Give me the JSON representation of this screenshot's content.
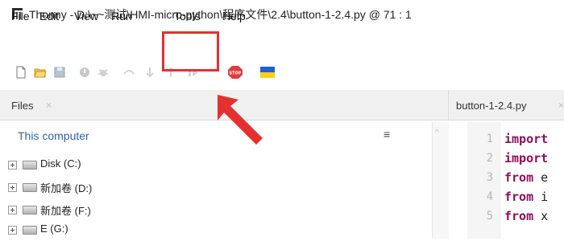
{
  "window": {
    "title": "Thonny  -  D:\\~~测试\\HMI-micro-python\\程序文件\\2.4\\button-1-2.4.py  @  71 : 1"
  },
  "menu": {
    "items": [
      "File",
      "Edit",
      "View",
      "Run",
      "Tools",
      "Help"
    ],
    "highlighted": "Tools"
  },
  "toolbar": {
    "icons": [
      "new-file-icon",
      "open-folder-icon",
      "save-icon",
      "run-icon",
      "debug-icon",
      "step-over-icon",
      "step-into-icon",
      "step-out-icon",
      "resume-icon",
      "stop-icon",
      "ukraine-flag-icon"
    ]
  },
  "files": {
    "tab_label": "Files",
    "tab_close": "×",
    "location": "This computer",
    "menu_glyph": "≡",
    "drives": [
      "Disk (C:)",
      "新加卷 (D:)",
      "新加卷 (F:)",
      "E (G:)"
    ]
  },
  "editor": {
    "tab_label": "button-1-2.4.py",
    "tab_close": "×",
    "lines": [
      {
        "no": "1",
        "kw": "import",
        "rest": ""
      },
      {
        "no": "2",
        "kw": "import",
        "rest": ""
      },
      {
        "no": "3",
        "kw": "from",
        "rest": " e"
      },
      {
        "no": "4",
        "kw": "from",
        "rest": " i"
      },
      {
        "no": "5",
        "kw": "from",
        "rest": " x"
      }
    ]
  },
  "colors": {
    "annotation": "#e53030",
    "keyword": "#8b0f5a",
    "location_link": "#2f63a8"
  }
}
